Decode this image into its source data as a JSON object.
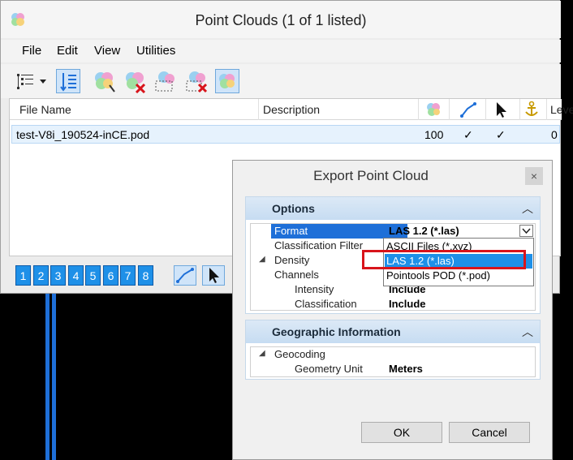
{
  "window": {
    "title": "Point Clouds (1 of 1 listed)"
  },
  "menu": {
    "items": [
      "File",
      "Edit",
      "View",
      "Utilities"
    ]
  },
  "toolbar": {
    "icons": [
      "tree-view-icon",
      "dropdown-arrow-icon",
      "list-view-icon",
      "attach-cloud-icon",
      "detach-cloud-icon",
      "export-cloud-icon",
      "remove-cloud-icon",
      "cloud-settings-icon"
    ]
  },
  "list": {
    "columns": {
      "file_name": "File Name",
      "description": "Description",
      "level": "Leve"
    },
    "rows": [
      {
        "file_name": "test-V8i_190524-inCE.pod",
        "density": "100",
        "snap": "✓",
        "locate": "✓",
        "level": "0"
      }
    ]
  },
  "views": {
    "buttons": [
      "1",
      "2",
      "3",
      "4",
      "5",
      "6",
      "7",
      "8"
    ]
  },
  "dialog": {
    "title": "Export Point Cloud",
    "close": "×",
    "options": {
      "title": "Options",
      "format_label": "Format",
      "format_value": "LAS 1.2 (*.las)",
      "classification_filter_label": "Classification Filter",
      "density_label": "Density",
      "channels_label": "Channels",
      "intensity_label": "Intensity",
      "intensity_value": "Include",
      "classification_label": "Classification",
      "classification_value": "Include"
    },
    "dropdown": {
      "options": [
        "ASCII Files (*.xyz)",
        "LAS 1.2 (*.las)",
        "Pointools POD (*.pod)"
      ],
      "selected": "LAS 1.2 (*.las)"
    },
    "geo": {
      "title": "Geographic Information",
      "geocoding_label": "Geocoding",
      "geometry_unit_label": "Geometry Unit",
      "geometry_unit_value": "Meters"
    },
    "ok": "OK",
    "cancel": "Cancel"
  },
  "colors": {
    "selection": "#1e90e8",
    "highlight_box": "#d8141b",
    "section_header": "#c6dcf2"
  }
}
